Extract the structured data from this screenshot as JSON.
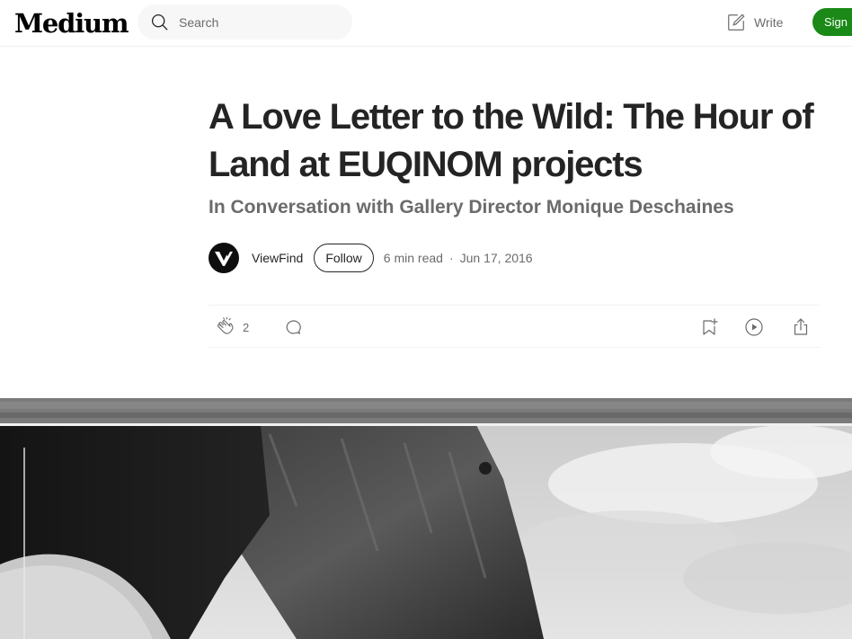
{
  "header": {
    "logo": "Medium",
    "search_placeholder": "Search",
    "write_label": "Write",
    "signup_label": "Sign"
  },
  "article": {
    "title": "A Love Letter to the Wild: The Hour of Land at EUQINOM projects",
    "subtitle": "In Conversation with Gallery Director Monique Deschaines",
    "author": "ViewFind",
    "follow_label": "Follow",
    "read_time": "6 min read",
    "separator": "·",
    "date": "Jun 17, 2016"
  },
  "actions": {
    "clap_count": "2"
  },
  "icons": {
    "search": "search-icon",
    "write": "write-icon",
    "avatar": "viewfind-logo",
    "clap": "clap-icon",
    "comment": "comment-icon",
    "save": "bookmark-add-icon",
    "listen": "play-icon",
    "share": "share-icon"
  },
  "colors": {
    "brand_green": "#1a8917",
    "text_primary": "#242424",
    "text_secondary": "#6b6b6b"
  }
}
